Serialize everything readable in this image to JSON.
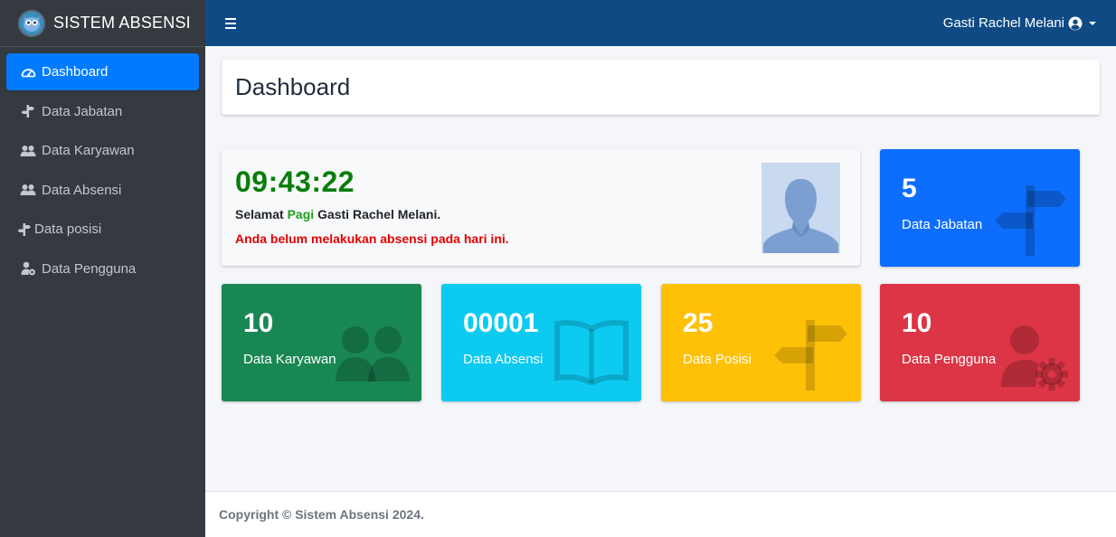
{
  "brand": {
    "title": "SISTEM ABSENSI"
  },
  "sidebar": {
    "items": [
      {
        "label": "Dashboard",
        "icon": "speedometer-icon",
        "active": true
      },
      {
        "label": "Data Jabatan",
        "icon": "signpost-icon"
      },
      {
        "label": "Data Karyawan",
        "icon": "users-icon"
      },
      {
        "label": "Data Absensi",
        "icon": "users-icon"
      },
      {
        "label": "Data posisi",
        "icon": "signpost-icon"
      },
      {
        "label": "Data Pengguna",
        "icon": "user-gear-icon"
      }
    ]
  },
  "topbar": {
    "user_name": "Gasti Rachel Melani"
  },
  "main": {
    "title": "Dashboard",
    "clock": {
      "time": "09:43:22",
      "greeting_prefix": "Selamat",
      "greeting_period": "Pagi",
      "greeting_suffix": "Gasti Rachel Melani.",
      "warning": "Anda belum melakukan absensi pada hari ini."
    },
    "stats": {
      "jabatan": {
        "value": "5",
        "label": "Data Jabatan",
        "icon": "signpost-icon",
        "color": "#0d6efd"
      },
      "karyawan": {
        "value": "10",
        "label": "Data Karyawan",
        "icon": "users-icon",
        "color": "#198754"
      },
      "absensi": {
        "value": "00001",
        "label": "Data Absensi",
        "icon": "book-open-icon",
        "color": "#0dcaf0"
      },
      "posisi": {
        "value": "25",
        "label": "Data Posisi",
        "icon": "signpost-icon",
        "color": "#ffc107"
      },
      "pengguna": {
        "value": "10",
        "label": "Data Pengguna",
        "icon": "user-gear-icon",
        "color": "#dc3545"
      }
    }
  },
  "footer": {
    "copyright": "Copyright © Sistem Absensi 2024."
  }
}
